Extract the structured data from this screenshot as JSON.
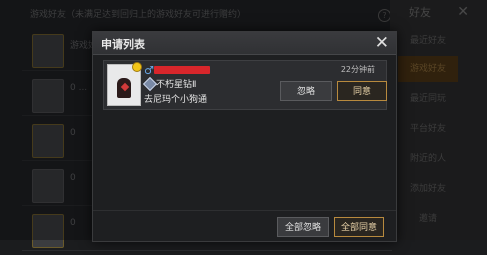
{
  "background": {
    "header_text": "游戏好友（未满足达到回归上的游戏好友可进行赠约）",
    "rows": [
      {
        "text": "游戏好友"
      },
      {
        "text": "0 ..."
      },
      {
        "text": "0"
      },
      {
        "text": "0"
      },
      {
        "text": "0"
      }
    ],
    "right_panel": {
      "title": "好友",
      "items": [
        {
          "label": "最近好友",
          "active": false
        },
        {
          "label": "游戏好友",
          "active": true
        },
        {
          "label": "最近同玩",
          "active": false
        },
        {
          "label": "平台好友",
          "active": false
        },
        {
          "label": "附近的人",
          "active": false
        },
        {
          "label": "添加好友",
          "active": false
        },
        {
          "label": "邀请",
          "active": false
        }
      ]
    }
  },
  "dialog": {
    "title": "申请列表",
    "close_icon": "close-icon",
    "requests": [
      {
        "gender": "♂",
        "rank": "不朽星钻Ⅱ",
        "message": "去尼玛个小狗通",
        "time": "22分钟前",
        "ignore_label": "忽略",
        "agree_label": "同意"
      }
    ],
    "ignore_all_label": "全部忽略",
    "agree_all_label": "全部同意"
  },
  "colors": {
    "accent_gold": "#b88a3e",
    "redacted_name": "#d8262b",
    "male_blue": "#6aa9e8"
  }
}
